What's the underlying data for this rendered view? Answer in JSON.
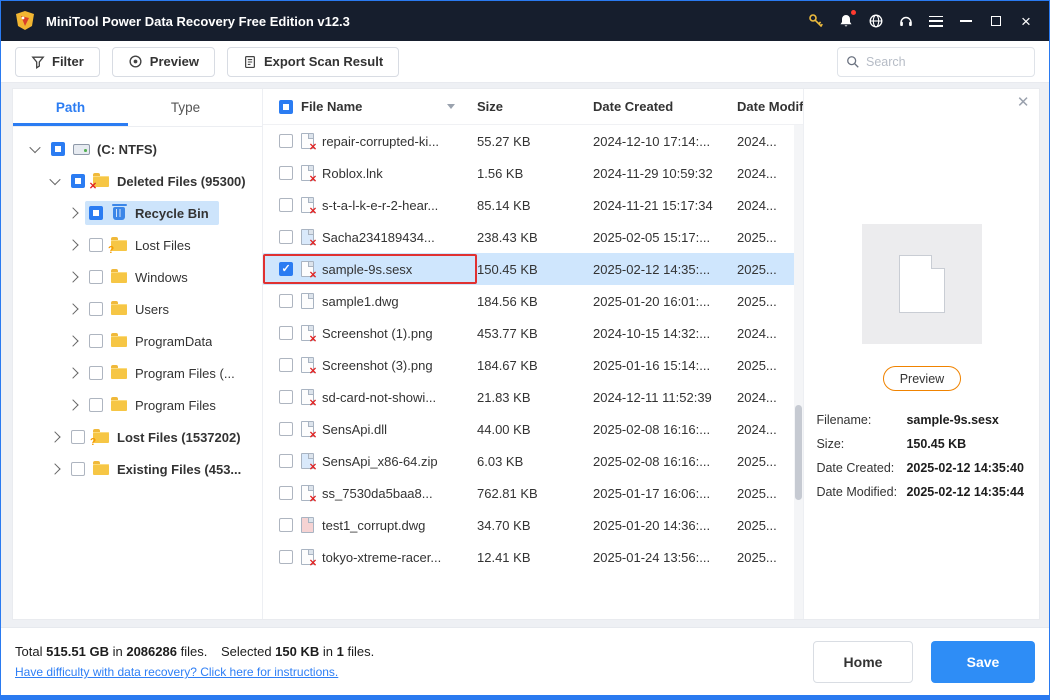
{
  "window": {
    "title": "MiniTool Power Data Recovery Free Edition v12.3"
  },
  "icons": {
    "app_logo": "minitool-logo",
    "titlebar": [
      "key",
      "bell-notification",
      "globe-language",
      "headset-support",
      "hamburger-menu",
      "minimize",
      "maximize",
      "close"
    ],
    "filter": "funnel",
    "preview": "eye",
    "export": "document",
    "search": "magnifier",
    "tree": [
      "hard-drive",
      "folder-red-x",
      "recycle-bin",
      "folder-orange-question",
      "yellow-folder"
    ],
    "file_row": "document-with-red-x",
    "sort": "down-triangle",
    "preview_thumb": "blank-document"
  },
  "toolbar": {
    "filter_label": "Filter",
    "preview_label": "Preview",
    "export_label": "Export Scan Result",
    "search_placeholder": "Search"
  },
  "tabs": {
    "path": "Path",
    "type": "Type"
  },
  "tree": {
    "items": [
      {
        "label": "(C: NTFS)"
      },
      {
        "label": "Deleted Files (95300)"
      },
      {
        "label": "Recycle Bin"
      },
      {
        "label": "Lost Files"
      },
      {
        "label": "Windows"
      },
      {
        "label": "Users"
      },
      {
        "label": "ProgramData"
      },
      {
        "label": "Program Files (..."
      },
      {
        "label": "Program Files"
      },
      {
        "label": "Lost Files (1537202)"
      },
      {
        "label": "Existing Files (453..."
      }
    ]
  },
  "table": {
    "headers": {
      "name": "File Name",
      "size": "Size",
      "created": "Date Created",
      "modified": "Date Modif"
    },
    "rows": [
      {
        "name": "repair-corrupted-ki...",
        "size": "55.27 KB",
        "created": "2024-12-10 17:14:...",
        "modified": "2024..."
      },
      {
        "name": "Roblox.lnk",
        "size": "1.56 KB",
        "created": "2024-11-29 10:59:32",
        "modified": "2024..."
      },
      {
        "name": "s-t-a-l-k-e-r-2-hear...",
        "size": "85.14 KB",
        "created": "2024-11-21 15:17:34",
        "modified": "2024..."
      },
      {
        "name": "Sacha234189434...",
        "size": "238.43 KB",
        "created": "2025-02-05 15:17:...",
        "modified": "2025..."
      },
      {
        "name": "sample-9s.sesx",
        "size": "150.45 KB",
        "created": "2025-02-12 14:35:...",
        "modified": "2025..."
      },
      {
        "name": "sample1.dwg",
        "size": "184.56 KB",
        "created": "2025-01-20 16:01:...",
        "modified": "2025..."
      },
      {
        "name": "Screenshot (1).png",
        "size": "453.77 KB",
        "created": "2024-10-15 14:32:...",
        "modified": "2024..."
      },
      {
        "name": "Screenshot (3).png",
        "size": "184.67 KB",
        "created": "2025-01-16 15:14:...",
        "modified": "2025..."
      },
      {
        "name": "sd-card-not-showi...",
        "size": "21.83 KB",
        "created": "2024-12-11 11:52:39",
        "modified": "2024..."
      },
      {
        "name": "SensApi.dll",
        "size": "44.00 KB",
        "created": "2025-02-08 16:16:...",
        "modified": "2024..."
      },
      {
        "name": "SensApi_x86-64.zip",
        "size": "6.03 KB",
        "created": "2025-02-08 16:16:...",
        "modified": "2025..."
      },
      {
        "name": "ss_7530da5baa8...",
        "size": "762.81 KB",
        "created": "2025-01-17 16:06:...",
        "modified": "2025..."
      },
      {
        "name": "test1_corrupt.dwg",
        "size": "34.70 KB",
        "created": "2025-01-20 14:36:...",
        "modified": "2025..."
      },
      {
        "name": "tokyo-xtreme-racer...",
        "size": "12.41 KB",
        "created": "2025-01-24 13:56:...",
        "modified": "2025..."
      }
    ]
  },
  "preview": {
    "close_glyph": "✕",
    "button_label": "Preview",
    "fields": [
      {
        "label": "Filename:",
        "value": "sample-9s.sesx"
      },
      {
        "label": "Size:",
        "value": "150.45 KB"
      },
      {
        "label": "Date Created:",
        "value": "2025-02-12 14:35:40"
      },
      {
        "label": "Date Modified:",
        "value": "2025-02-12 14:35:44"
      }
    ]
  },
  "footer": {
    "total_label": "Total",
    "total_size": "515.51 GB",
    "in_a": "in",
    "total_count": "2086286",
    "files_a": "files.",
    "selected_label": "Selected",
    "selected_size": "150 KB",
    "in_b": "in",
    "selected_count": "1",
    "files_b": "files.",
    "help_link": "Have difficulty with data recovery? Click here for instructions.",
    "home_label": "Home",
    "save_label": "Save"
  }
}
